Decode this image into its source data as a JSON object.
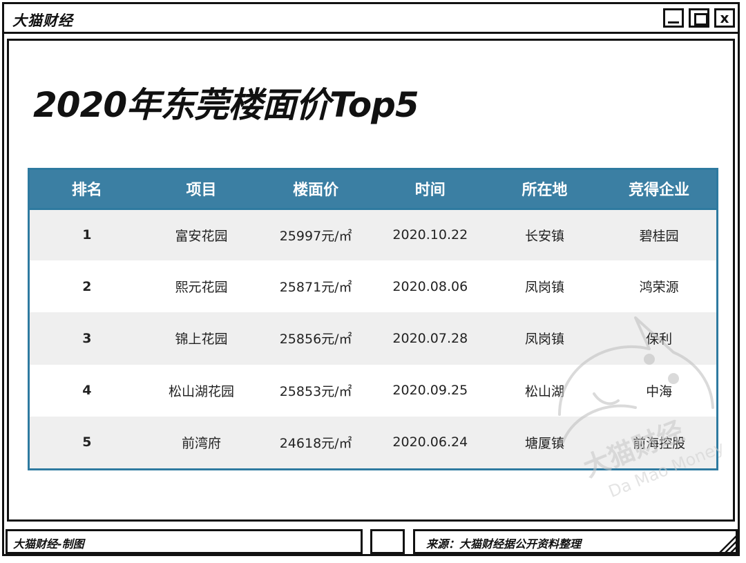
{
  "window": {
    "title": "大猫财经",
    "close_glyph": "x"
  },
  "page": {
    "title": "2020年东莞楼面价Top5"
  },
  "table": {
    "headers": [
      "排名",
      "项目",
      "楼面价",
      "时间",
      "所在地",
      "竞得企业"
    ],
    "rows": [
      [
        "1",
        "富安花园",
        "25997元/㎡",
        "2020.10.22",
        "长安镇",
        "碧桂园"
      ],
      [
        "2",
        "熙元花园",
        "25871元/㎡",
        "2020.08.06",
        "凤岗镇",
        "鸿荣源"
      ],
      [
        "3",
        "锦上花园",
        "25856元/㎡",
        "2020.07.28",
        "凤岗镇",
        "保利"
      ],
      [
        "4",
        "松山湖花园",
        "25853元/㎡",
        "2020.09.25",
        "松山湖",
        "中海"
      ],
      [
        "5",
        "前湾府",
        "24618元/㎡",
        "2020.06.24",
        "塘厦镇",
        "前海控股"
      ]
    ]
  },
  "watermark": {
    "brand": "大猫财经",
    "english": "Da Mao Money"
  },
  "footer": {
    "left": "大猫财经-制图",
    "right": "来源：大猫财经据公开资料整理"
  },
  "colors": {
    "header_bg": "#3b7fa3",
    "border": "#2e7aa0",
    "stripe": "#efefef"
  }
}
